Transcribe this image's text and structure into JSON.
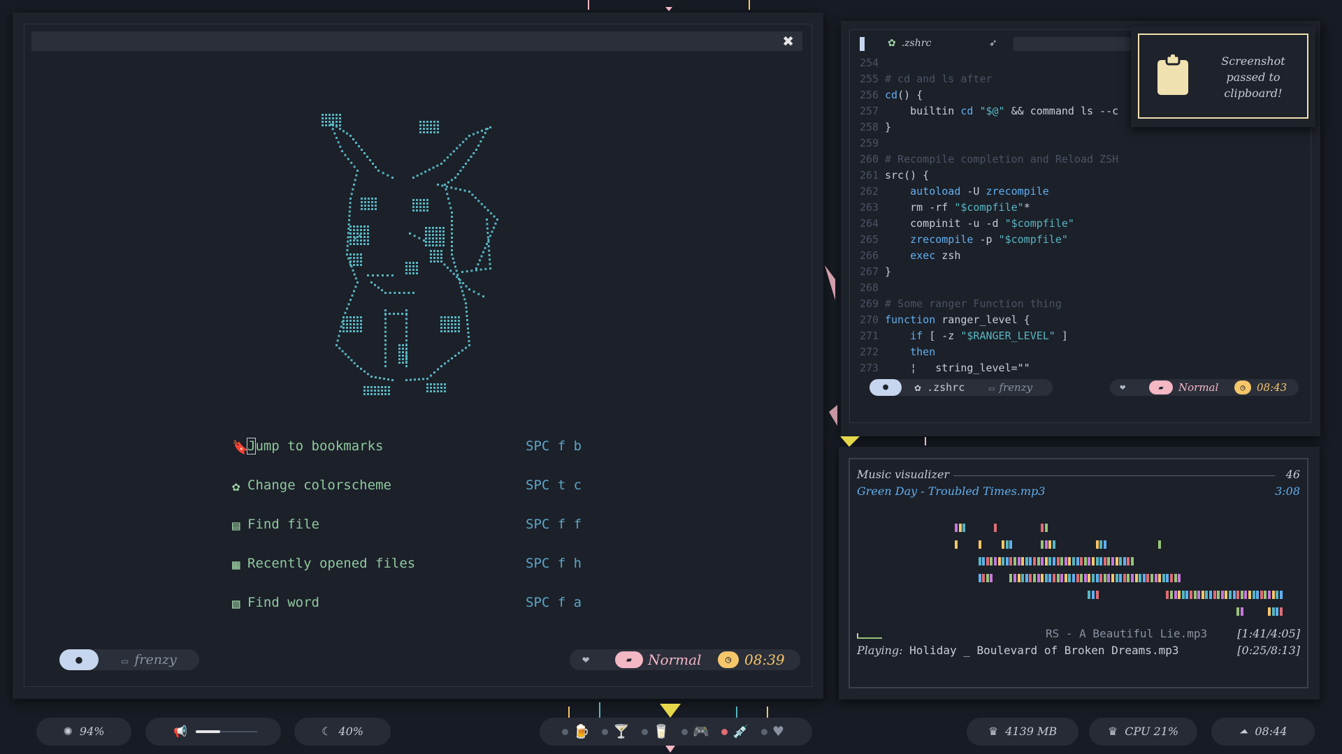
{
  "colors": {
    "background": "#171b23",
    "accent_cyan": "#56b6c2",
    "accent_green": "#8fc99e",
    "mode_pink": "#f4b7c4",
    "clock_yellow": "#f5c66a",
    "ghost_blue": "#c6d6ee"
  },
  "left_window": {
    "close_icon": "close-icon",
    "ascii_art": "pikachu-ascii-art",
    "menu": [
      {
        "icon": "bookmark-icon",
        "glyph": "🔖",
        "label": "Jump to bookmarks",
        "shortcut": "SPC f b"
      },
      {
        "icon": "palette-icon",
        "glyph": "✿",
        "label": "Change colorscheme",
        "shortcut": "SPC t c"
      },
      {
        "icon": "file-icon",
        "glyph": "▤",
        "label": "Find file",
        "shortcut": "SPC f f"
      },
      {
        "icon": "files-icon",
        "glyph": "▦",
        "label": "Recently opened files",
        "shortcut": "SPC f h"
      },
      {
        "icon": "word-file-icon",
        "glyph": "▧",
        "label": "Find word",
        "shortcut": "SPC f a"
      }
    ],
    "statusline": {
      "ghost_icon": "ghost-icon",
      "branch_icon": "folder-icon",
      "branch": "frenzy",
      "heart_icon": "heart-icon",
      "mode_icon": "vim-icon",
      "mode": "Normal",
      "clock_icon": "clock-icon",
      "time": "08:39"
    }
  },
  "right_window": {
    "tab": {
      "icon": "gear-icon",
      "label": ".zshrc",
      "rocket_icon": "rocket-icon"
    },
    "code_lines": [
      {
        "n": "254",
        "parts": []
      },
      {
        "n": "255",
        "parts": [
          {
            "t": "# cd and ls after",
            "c": "comment"
          }
        ]
      },
      {
        "n": "256",
        "parts": [
          {
            "t": "cd",
            "c": "kw"
          },
          {
            "t": "() {",
            "c": "plain"
          }
        ]
      },
      {
        "n": "257",
        "parts": [
          {
            "t": "    builtin ",
            "c": "plain"
          },
          {
            "t": "cd",
            "c": "kw"
          },
          {
            "t": " ",
            "c": "plain"
          },
          {
            "t": "\"$@\"",
            "c": "str"
          },
          {
            "t": " && command ls --c",
            "c": "plain"
          }
        ]
      },
      {
        "n": "258",
        "parts": [
          {
            "t": "}",
            "c": "plain"
          }
        ]
      },
      {
        "n": "259",
        "parts": []
      },
      {
        "n": "260",
        "parts": [
          {
            "t": "# Recompile completion and Reload ZSH",
            "c": "comment"
          }
        ]
      },
      {
        "n": "261",
        "parts": [
          {
            "t": "src() {",
            "c": "plain"
          }
        ]
      },
      {
        "n": "262",
        "parts": [
          {
            "t": "    ",
            "c": "plain"
          },
          {
            "t": "autoload",
            "c": "kw"
          },
          {
            "t": " -U ",
            "c": "plain"
          },
          {
            "t": "zrecompile",
            "c": "kw"
          }
        ]
      },
      {
        "n": "263",
        "parts": [
          {
            "t": "    rm -rf ",
            "c": "plain"
          },
          {
            "t": "\"$compfile\"",
            "c": "str"
          },
          {
            "t": "*",
            "c": "plain"
          }
        ]
      },
      {
        "n": "264",
        "parts": [
          {
            "t": "    compinit -u -d ",
            "c": "plain"
          },
          {
            "t": "\"$compfile\"",
            "c": "str"
          }
        ]
      },
      {
        "n": "265",
        "parts": [
          {
            "t": "    ",
            "c": "plain"
          },
          {
            "t": "zrecompile",
            "c": "kw"
          },
          {
            "t": " -p ",
            "c": "plain"
          },
          {
            "t": "\"$compfile\"",
            "c": "str"
          }
        ]
      },
      {
        "n": "266",
        "parts": [
          {
            "t": "    ",
            "c": "plain"
          },
          {
            "t": "exec",
            "c": "kw"
          },
          {
            "t": " zsh",
            "c": "plain"
          }
        ]
      },
      {
        "n": "267",
        "parts": [
          {
            "t": "}",
            "c": "plain"
          }
        ]
      },
      {
        "n": "268",
        "parts": []
      },
      {
        "n": "269",
        "parts": [
          {
            "t": "# Some ranger Function thing",
            "c": "comment"
          }
        ]
      },
      {
        "n": "270",
        "parts": [
          {
            "t": "function",
            "c": "kw"
          },
          {
            "t": " ranger_level {",
            "c": "plain"
          }
        ]
      },
      {
        "n": "271",
        "parts": [
          {
            "t": "    ",
            "c": "plain"
          },
          {
            "t": "if",
            "c": "kw"
          },
          {
            "t": " [ -z ",
            "c": "plain"
          },
          {
            "t": "\"$RANGER_LEVEL\"",
            "c": "str"
          },
          {
            "t": " ]",
            "c": "plain"
          }
        ]
      },
      {
        "n": "272",
        "parts": [
          {
            "t": "    ",
            "c": "plain"
          },
          {
            "t": "then",
            "c": "kw"
          }
        ]
      },
      {
        "n": "273",
        "parts": [
          {
            "t": "    ¦   string_level=\"\"",
            "c": "plain"
          }
        ]
      }
    ],
    "statusline": {
      "ghost_icon": "ghost-icon",
      "file_icon": "gear-icon",
      "file": ".zshrc",
      "branch_icon": "folder-icon",
      "branch": "frenzy",
      "heart_icon": "heart-icon",
      "mode_icon": "vim-icon",
      "mode": "Normal",
      "clock_icon": "clock-icon",
      "time": "08:43"
    }
  },
  "notification": {
    "icon": "clipboard-icon",
    "line1": "Screenshot",
    "line2": "passed to",
    "line3": "clipboard!"
  },
  "music": {
    "title": "Music visualizer",
    "count": "46",
    "current_song": "Green Day - Troubled Times.mp3",
    "current_duration": "3:08",
    "next_song": "RS -  A Beautiful Lie.mp3",
    "next_time": "[1:41/4:05]",
    "playing_label": "Playing:",
    "playing_song": "Holiday _ Boulevard of Broken Dreams.mp3",
    "playing_time": "[0:25/8:13]",
    "progress_fraction": 0.2
  },
  "bar": {
    "battery": {
      "icon": "battery-icon",
      "value": "94%"
    },
    "volume": {
      "icon": "megaphone-icon",
      "level": 0.4
    },
    "brightness": {
      "icon": "moon-icon",
      "value": "40%"
    },
    "workspaces": [
      {
        "icon": "beer-icon",
        "glyph": "🍺",
        "color": "#f0e2b0"
      },
      {
        "icon": "cocktail-icon",
        "glyph": "🍸",
        "color": "#f4b7c4"
      },
      {
        "icon": "glass-icon",
        "glyph": "🥛",
        "color": "#c6d6ee"
      },
      {
        "icon": "gamepad-icon",
        "glyph": "🎮",
        "color": "#f4b7c4"
      },
      {
        "icon": "syringe-icon",
        "glyph": "💉",
        "color": "#98c379"
      },
      {
        "icon": "heart-icon",
        "glyph": "♥",
        "color": "#8a91a0"
      }
    ],
    "ram": {
      "icon": "ram-icon",
      "value": "4139 MB"
    },
    "cpu": {
      "icon": "cpu-icon",
      "value": "CPU 21%"
    },
    "clock": {
      "icon": "clock-icon",
      "value": "08:44"
    }
  }
}
